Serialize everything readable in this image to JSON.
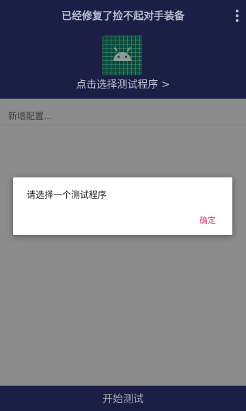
{
  "header": {
    "title": "已经修复了捡不起对手装备",
    "menu_icon": "more-vert-icon",
    "app_icon": "android-icon",
    "select_program_label": "点击选择测试程序 >"
  },
  "config": {
    "add_label": "新增配置..."
  },
  "dialog": {
    "message": "请选择一个测试程序",
    "ok_label": "确定"
  },
  "footer": {
    "start_label": "开始测试"
  },
  "colors": {
    "primary": "#1b1f45",
    "accent": "#e0457a",
    "scrim": "#8c8c8c"
  }
}
